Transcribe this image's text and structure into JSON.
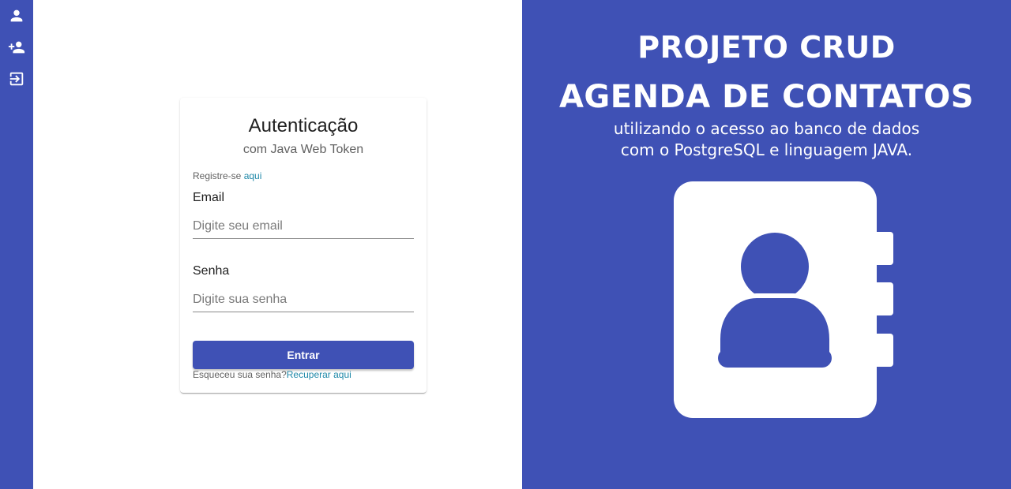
{
  "sidebar": {
    "items": [
      {
        "icon": "person-icon",
        "label": "Login"
      },
      {
        "icon": "person-add-icon",
        "label": "Register"
      },
      {
        "icon": "logout-icon",
        "label": "Logout"
      }
    ]
  },
  "login": {
    "title": "Autenticação",
    "subtitle": "com Java Web Token",
    "register_prefix": "Registre-se ",
    "register_link": "aqui",
    "email_label": "Email",
    "email_placeholder": "Digite seu email",
    "email_value": "",
    "password_label": "Senha",
    "password_placeholder": "Digite sua senha",
    "password_value": "",
    "submit_label": "Entrar",
    "forgot_prefix": "Esqueceu sua senha?",
    "forgot_link": "Recuperar aqui"
  },
  "promo": {
    "title_line1": "PROJETO CRUD",
    "title_line2": "AGENDA DE CONTATOS",
    "subtitle_line1": "utilizando o acesso ao banco de dados",
    "subtitle_line2": "com o PostgreSQL e linguagem JAVA.",
    "image_icon": "contact-book-icon"
  },
  "colors": {
    "primary": "#3f51b5",
    "link": "#1e88a8",
    "card_background": "#ffffff"
  }
}
